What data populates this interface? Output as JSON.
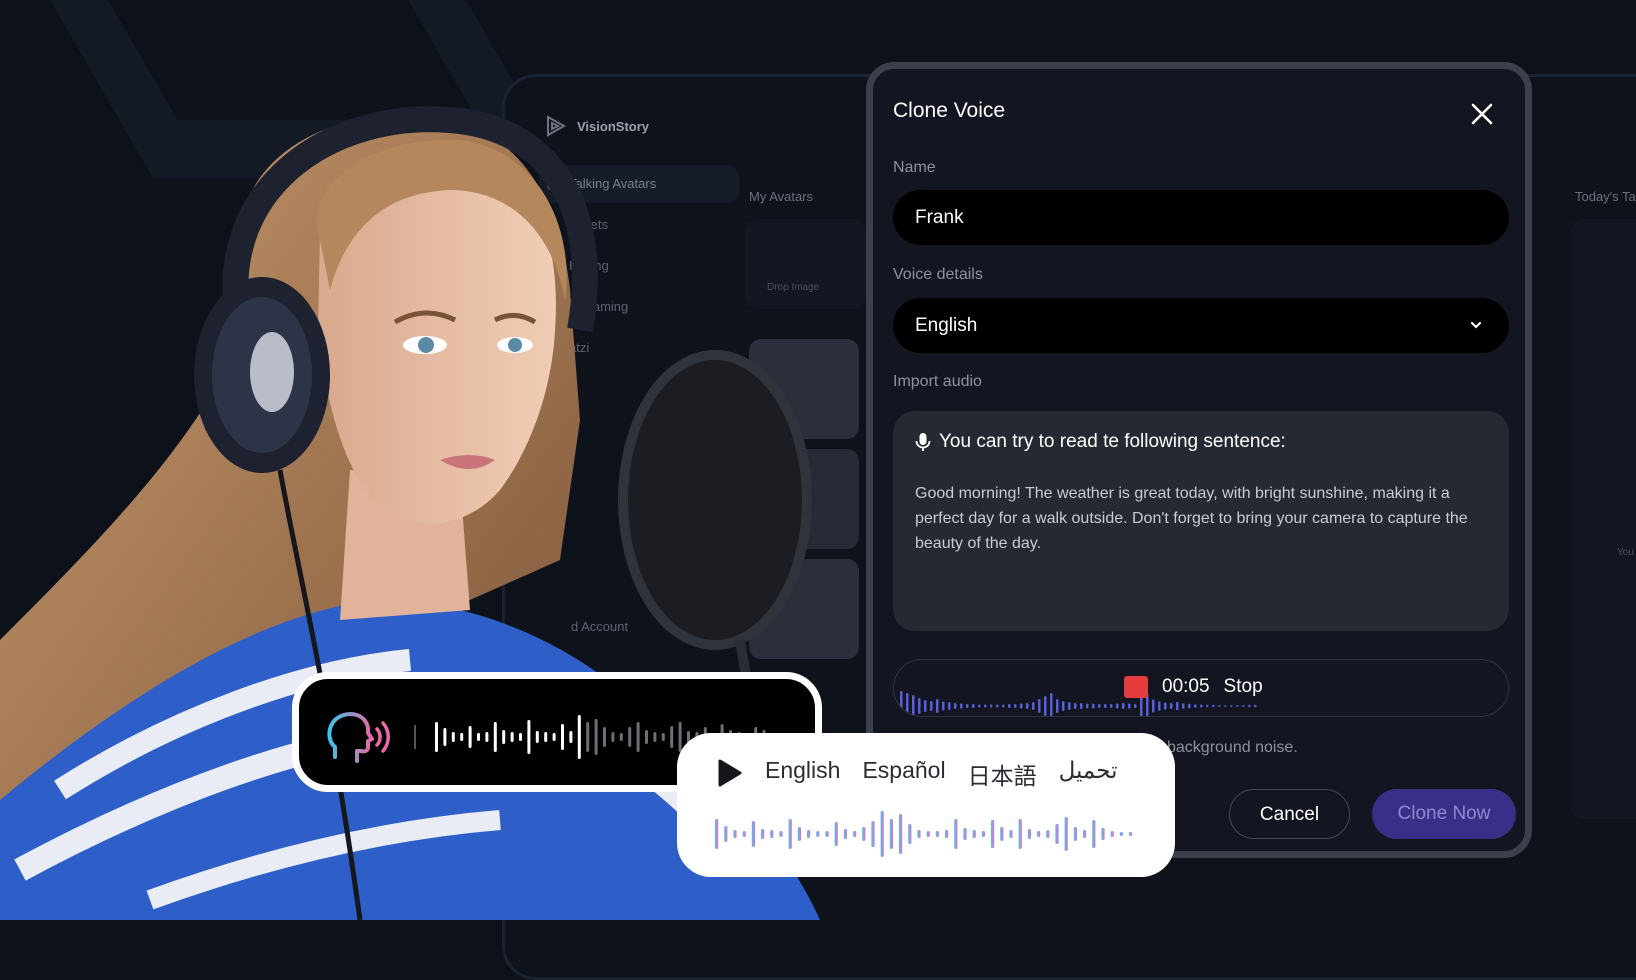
{
  "background_app": {
    "brand": "VisionStory",
    "nav": [
      {
        "label": "Talking Avatars"
      },
      {
        "label": "Assets"
      },
      {
        "label": "Pricing"
      },
      {
        "label": "Streaming"
      },
      {
        "label": "atzi"
      }
    ],
    "account_label": "d Account",
    "col1_title": "My Avatars",
    "col2_title": "Today's Ta",
    "drop_text": "Drop Image",
    "side_text": "You"
  },
  "modal": {
    "title": "Clone Voice",
    "name_label": "Name",
    "name_value": "Frank",
    "voice_label": "Voice details",
    "voice_value": "English",
    "import_label": "Import audio",
    "prompt_heading": "You can try to read te following sentence:",
    "prompt_text": "Good morning! The weather is great today, with bright sunshine, making it a perfect day for a walk outside. Don't forget to bring your camera to capture the beauty of the day.",
    "recording": {
      "time": "00:05",
      "stop_label": "Stop"
    },
    "noise_hint": "background noise.",
    "cancel_label": "Cancel",
    "clone_label": "Clone Now"
  },
  "language_card": {
    "languages": [
      "English",
      "Español",
      "日本語",
      "تحميل"
    ]
  },
  "colors": {
    "accent": "#3a2f87",
    "accent_text": "#8f86d6",
    "record_red": "#e53d3d",
    "wave_blue": "#3ec3e8",
    "wave_pink": "#e869a6"
  }
}
